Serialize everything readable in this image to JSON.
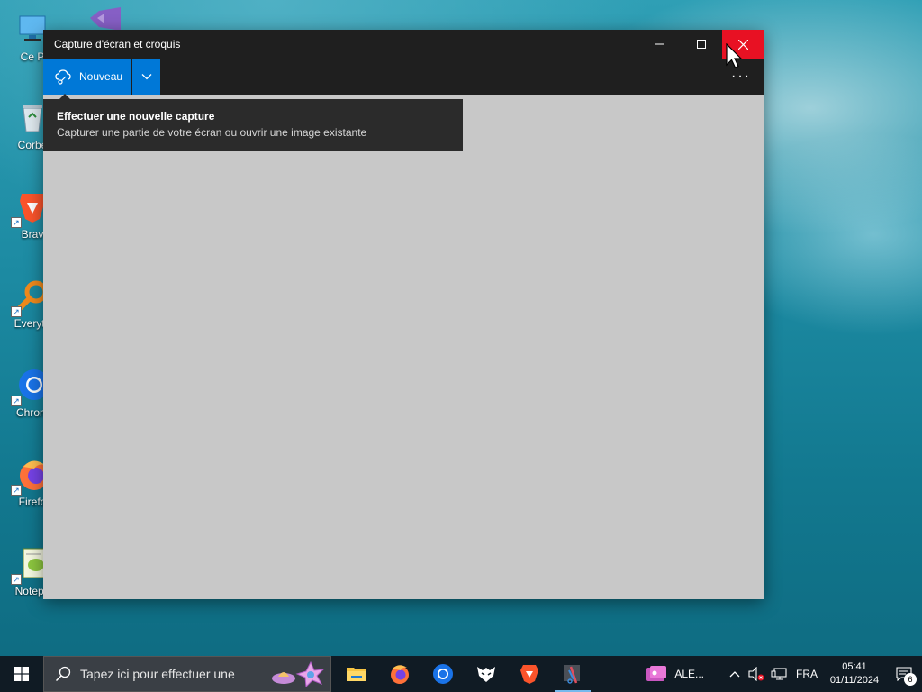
{
  "desktop": {
    "icons": [
      {
        "label": "Ce P",
        "icon": "computer-icon"
      },
      {
        "label": "Corbe",
        "icon": "recycle-bin-icon"
      },
      {
        "label": "Brav",
        "icon": "brave-icon"
      },
      {
        "label": "Everyth",
        "icon": "everything-search-icon"
      },
      {
        "label": "Chrom",
        "icon": "chrome-icon"
      },
      {
        "label": "Firefo",
        "icon": "firefox-icon"
      },
      {
        "label": "Notepa",
        "icon": "notepad-plus-icon"
      }
    ]
  },
  "window": {
    "title": "Capture d'écran et croquis",
    "new_label": "Nouveau",
    "more_label": "···"
  },
  "tooltip": {
    "title": "Effectuer une nouvelle capture",
    "description": "Capturer une partie de votre écran ou ouvrir une image existante"
  },
  "taskbar": {
    "search_placeholder": "Tapez ici pour effectuer une",
    "apps": [
      "file-explorer-icon",
      "firefox-icon",
      "chrome-icon",
      "wolf-app-icon",
      "brave-icon",
      "snip-sketch-icon"
    ],
    "notification_app_label": "ALE...",
    "language": "FRA",
    "time": "05:41",
    "date": "01/11/2024",
    "notification_count": "6"
  },
  "colors": {
    "accent": "#0078d7",
    "close_hover": "#e81123",
    "titlebar": "#1f1f1f",
    "canvas": "#c8c8c8"
  }
}
